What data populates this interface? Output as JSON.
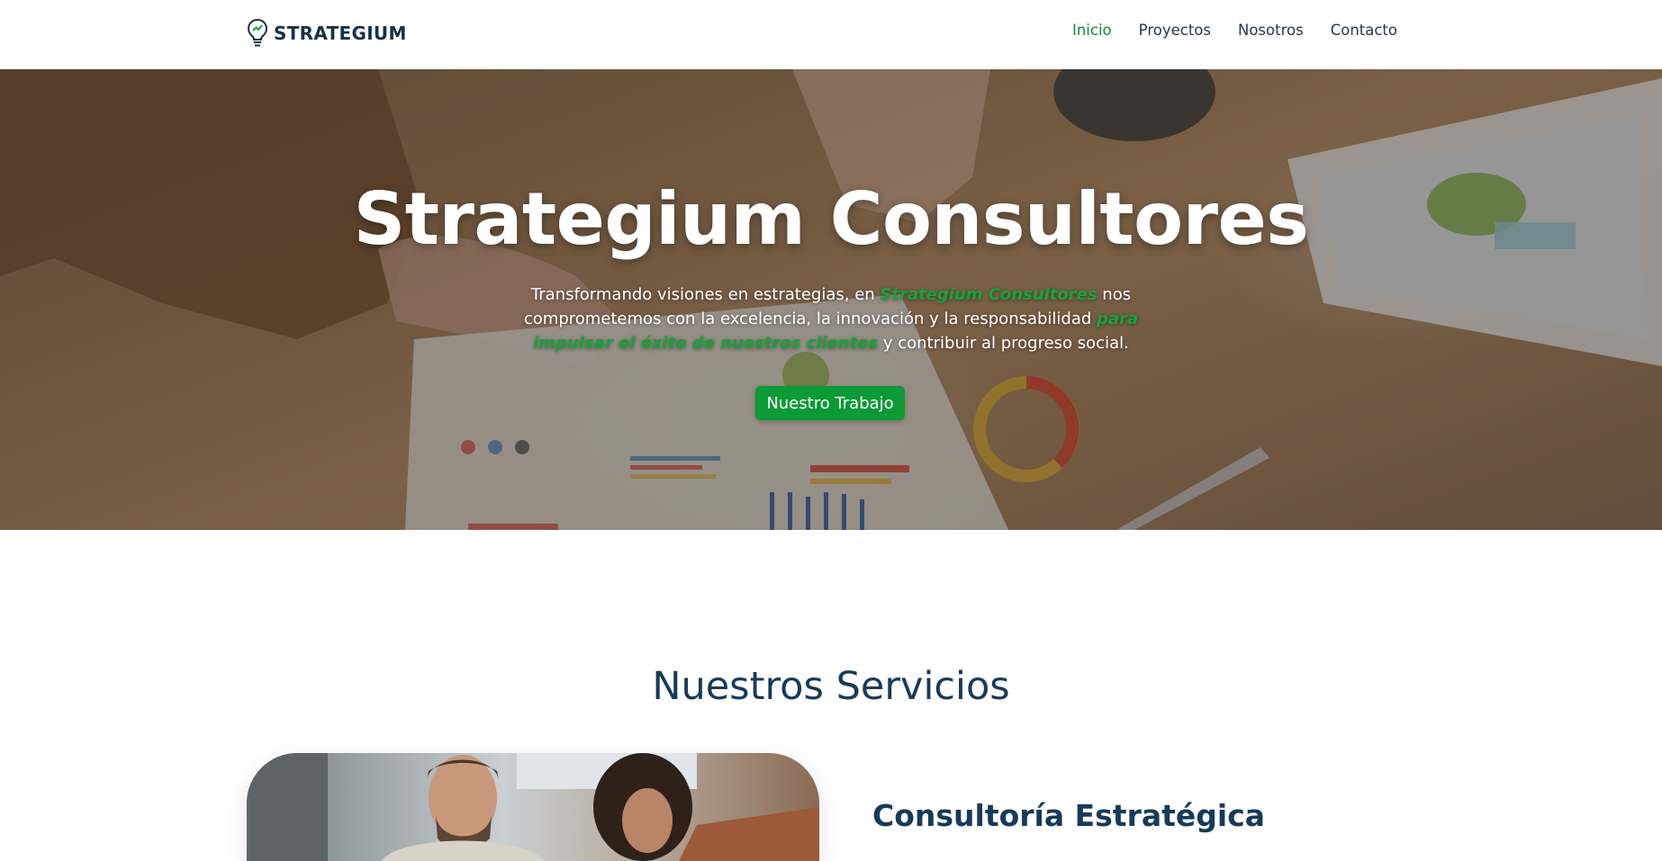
{
  "brand": {
    "name": "STRATEGIUM",
    "logo_icon": "lightbulb-icon"
  },
  "nav": {
    "items": [
      {
        "label": "Inicio",
        "active": true
      },
      {
        "label": "Proyectos",
        "active": false
      },
      {
        "label": "Nosotros",
        "active": false
      },
      {
        "label": "Contacto",
        "active": false
      }
    ]
  },
  "hero": {
    "title": "Strategium Consultores",
    "description": {
      "part1": "Transformando visiones en estrategias, en ",
      "highlight1": "Strategium Consultores",
      "part2": " nos comprometemos con la excelencia, la innovación y la responsabilidad ",
      "highlight2": "para impulsar el éxito de nuestros clientes",
      "part3": " y contribuir al progreso social."
    },
    "cta_label": "Nuestro Trabajo"
  },
  "services": {
    "title": "Nuestros Servicios",
    "items": [
      {
        "title": "Consultoría Estratégica"
      }
    ]
  },
  "colors": {
    "accent_green": "#0b9a35",
    "heading_navy": "#173a5a",
    "nav_active": "#12883b"
  }
}
